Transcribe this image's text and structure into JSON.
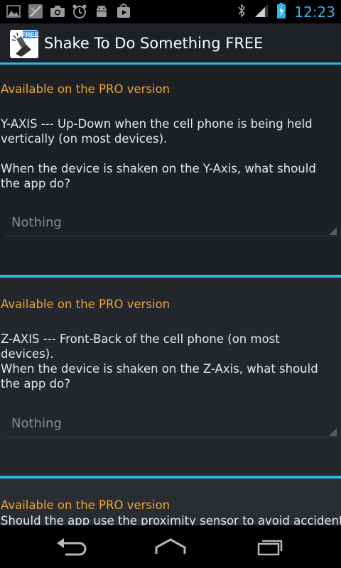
{
  "status_bar": {
    "time": "12:23",
    "notification_icons": [
      "image-icon",
      "map-icon",
      "camera-icon",
      "alarm-icon",
      "android-icon",
      "play-store-icon"
    ],
    "system_icons": [
      "bluetooth-icon",
      "signal-icon",
      "battery-icon"
    ]
  },
  "action_bar": {
    "title": "Shake To Do Something FREE",
    "app_icon_badge": "FREE"
  },
  "sections": [
    {
      "pro_notice": "Available on the PRO version",
      "axis_desc": "Y-AXIS --- Up-Down when the cell phone is being held vertically (on most devices).",
      "question": "When the device is shaken on the Y-Axis, what should the app do?",
      "spinner_value": "Nothing"
    },
    {
      "pro_notice": "Available on the PRO version",
      "axis_desc": "Z-AXIS --- Front-Back of the cell phone (on most devices).",
      "question": "When the device is shaken on the Z-Axis, what should the app do?",
      "spinner_value": "Nothing"
    },
    {
      "pro_notice": "Available on the PRO version",
      "axis_desc": "Should the app use the proximity sensor to avoid accidental"
    }
  ],
  "colors": {
    "accent": "#33b5e5",
    "pro_text": "#f0a33a",
    "background": "#1d2125"
  },
  "nav_bar": {
    "icons": [
      "back-icon",
      "home-icon",
      "recent-apps-icon"
    ]
  }
}
